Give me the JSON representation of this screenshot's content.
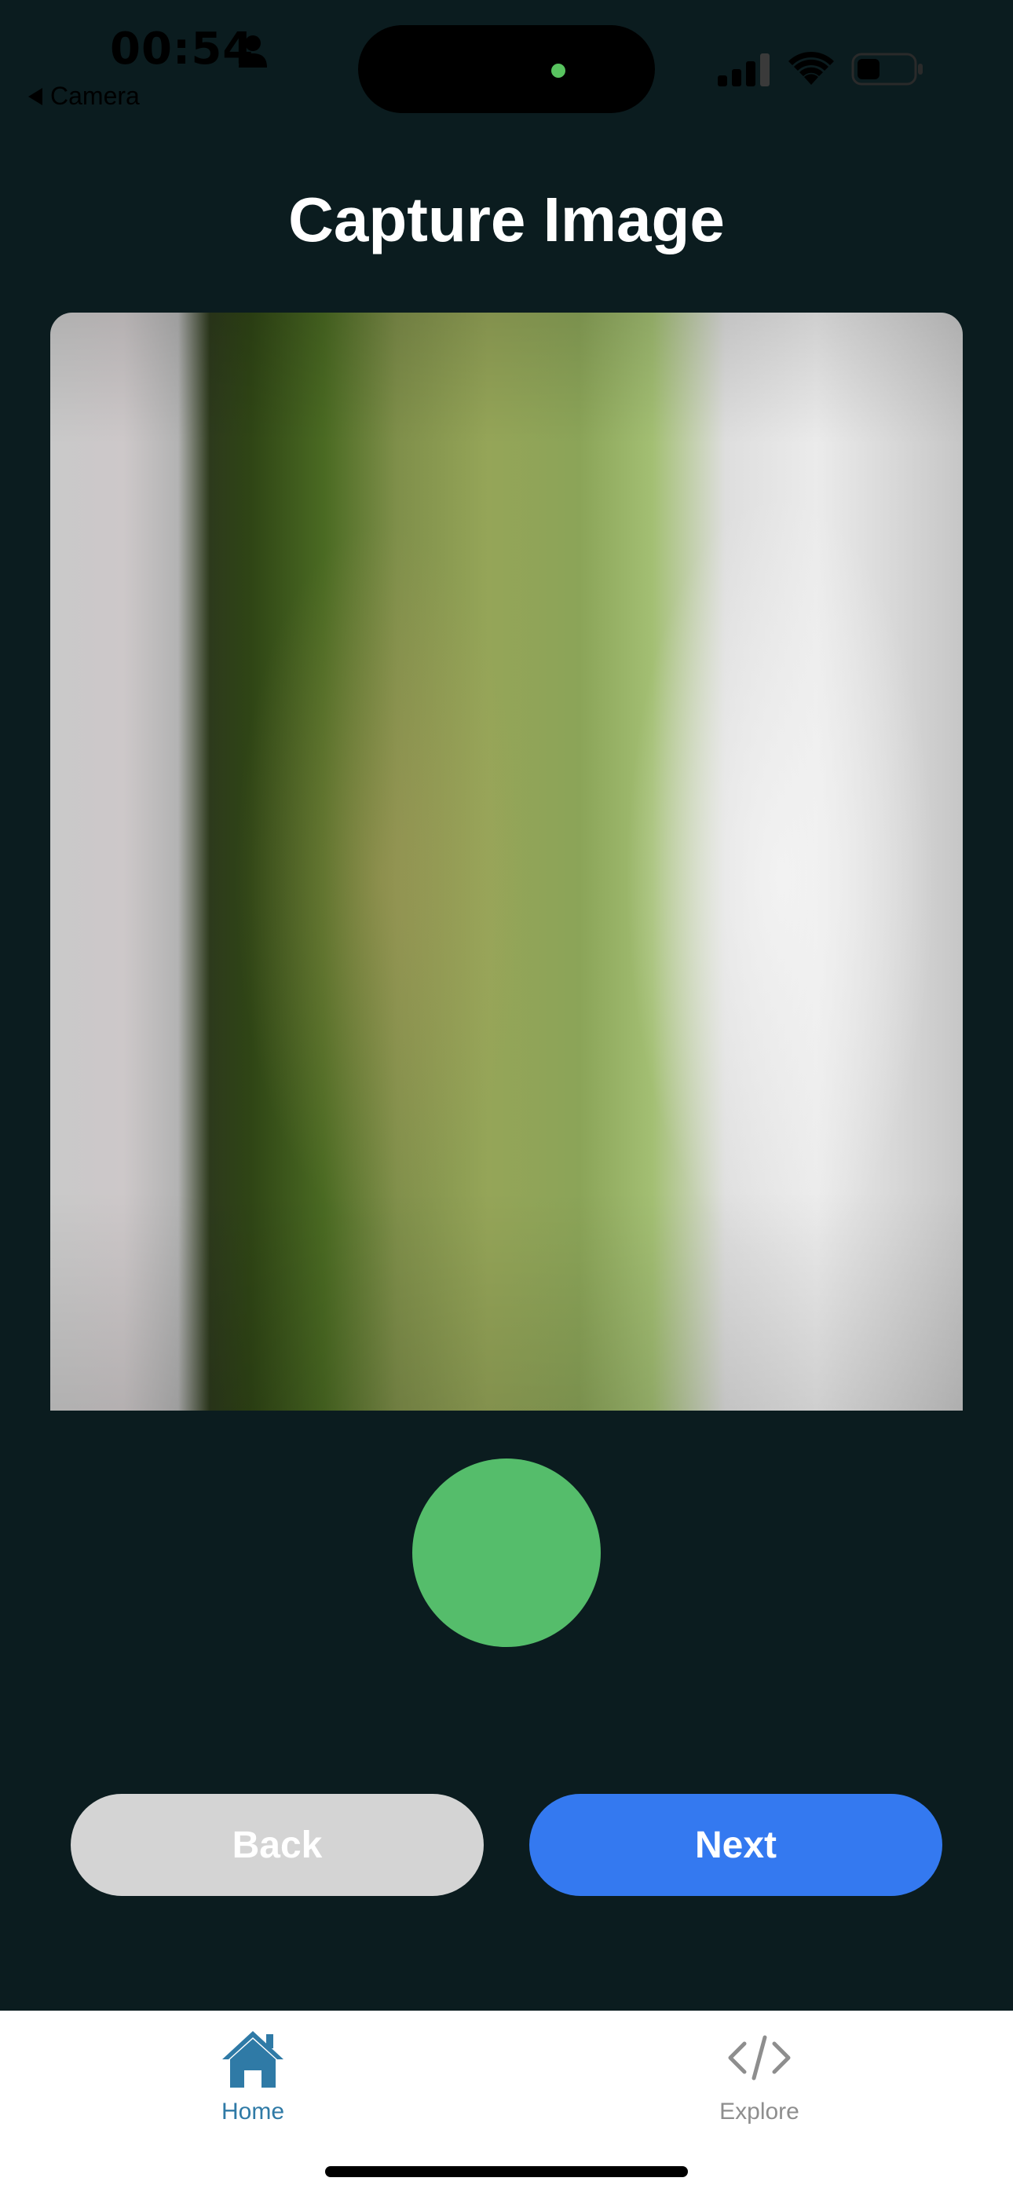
{
  "status_bar": {
    "time": "00:54",
    "back_app_label": "Camera"
  },
  "icons": {
    "person": "person-icon",
    "signal": "cellular-signal-icon",
    "wifi": "wifi-icon",
    "battery": "battery-icon",
    "home": "home-icon",
    "explore": "code-icon"
  },
  "page": {
    "title": "Capture Image"
  },
  "actions": {
    "back_label": "Back",
    "next_label": "Next"
  },
  "tab_bar": {
    "tabs": [
      {
        "label": "Home",
        "selected": true
      },
      {
        "label": "Explore",
        "selected": false
      }
    ]
  },
  "colors": {
    "background": "#0b1c1f",
    "shutter": "#55bd6b",
    "next_button": "#3479f0",
    "back_button": "#d4d4d4",
    "tab_active": "#2f7aa6",
    "tab_inactive": "#8e8e8e"
  }
}
